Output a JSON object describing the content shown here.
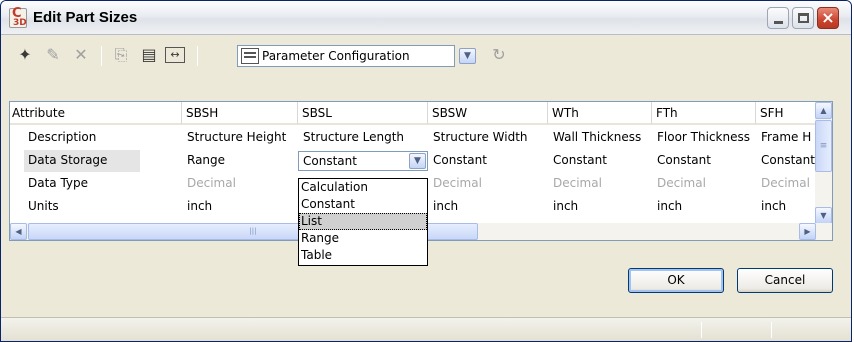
{
  "window": {
    "title": "Edit Part Sizes",
    "app_icon_text": "C",
    "app_icon_sub": "3D"
  },
  "titlebar_buttons": {
    "minimize": "minimize-icon",
    "maximize": "maximize-icon",
    "close": "×"
  },
  "toolbar": {
    "tools": [
      {
        "name": "new-icon",
        "glyph": "✦",
        "disabled": false
      },
      {
        "name": "edit-icon",
        "glyph": "✎",
        "disabled": true
      },
      {
        "name": "delete-icon",
        "glyph": "✕",
        "disabled": true
      },
      {
        "name": "copy-icon",
        "glyph": "⎘",
        "disabled": true
      },
      {
        "name": "paste-icon",
        "glyph": "▤",
        "disabled": false
      },
      {
        "name": "column-width-icon",
        "glyph": "↔",
        "disabled": false
      },
      {
        "name": "refresh-icon",
        "glyph": "↻",
        "disabled": true
      }
    ],
    "parameter_configuration": "Parameter Configuration",
    "dropdown_arrow": "▼"
  },
  "grid": {
    "columns": [
      "Attribute",
      "SBSH",
      "SBSL",
      "SBSW",
      "WTh",
      "FTh",
      "SFH"
    ],
    "rows": [
      {
        "attribute": "Description",
        "values": [
          "Structure Height",
          "Structure Length",
          "Structure Width",
          "Wall Thickness",
          "Floor Thickness",
          "Frame H"
        ]
      },
      {
        "attribute": "Data Storage",
        "values": [
          "Range",
          "Constant",
          "Constant",
          "Constant",
          "Constant",
          "Constant"
        ]
      },
      {
        "attribute": "Data Type",
        "values": [
          "Decimal",
          "",
          "Decimal",
          "Decimal",
          "Decimal",
          "Decimal"
        ]
      },
      {
        "attribute": "Units",
        "values": [
          "inch",
          "",
          "inch",
          "inch",
          "inch",
          "inch"
        ]
      }
    ],
    "editing_combo_value": "Constant",
    "scroll_up": "▲",
    "scroll_down": "▼",
    "scroll_left": "◀",
    "scroll_right": "▶",
    "hthumb_grip": "|||",
    "vthumb_grip": "≡"
  },
  "dropdown_options": [
    "Calculation",
    "Constant",
    "List",
    "Range",
    "Table"
  ],
  "dropdown_highlighted": "List",
  "buttons": {
    "ok": "OK",
    "cancel": "Cancel"
  }
}
